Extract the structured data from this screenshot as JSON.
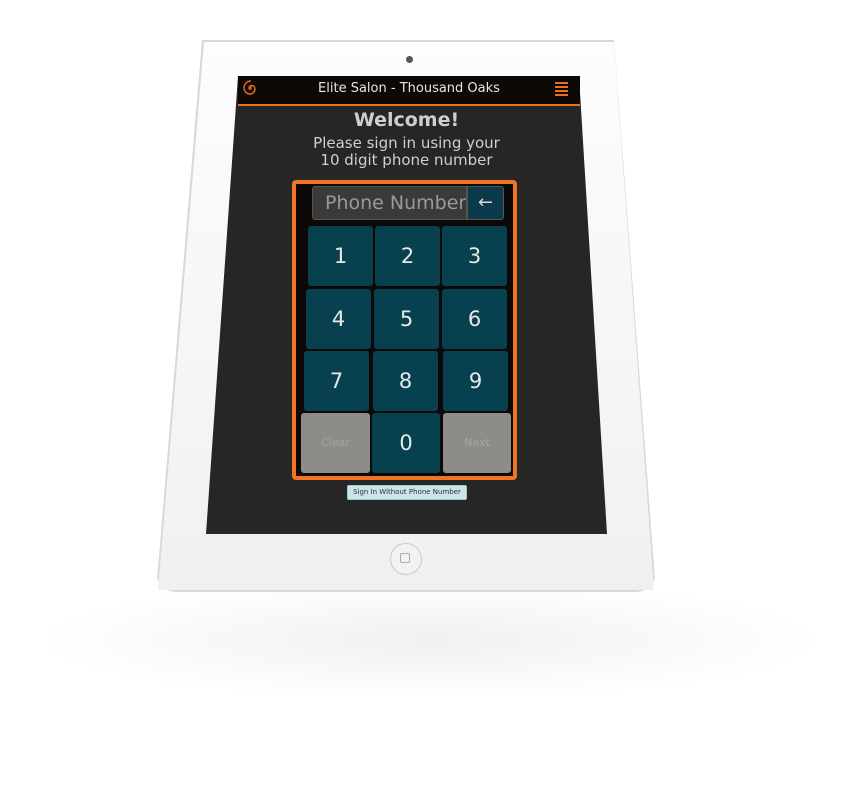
{
  "header": {
    "title": "Elite Salon - Thousand Oaks",
    "logo_icon": "spiral-logo-icon",
    "menu_icon": "hamburger-menu-icon"
  },
  "main": {
    "welcome": "Welcome!",
    "instructions_line1": "Please sign in using your",
    "instructions_line2": "10 digit phone number",
    "phone_input": {
      "value": "",
      "placeholder": "Phone Number"
    },
    "backspace_icon": "←",
    "keys": [
      "1",
      "2",
      "3",
      "4",
      "5",
      "6",
      "7",
      "8",
      "9",
      "Clear",
      "0",
      "Next"
    ],
    "sign_in_without_phone": "Sign In Without Phone Number"
  },
  "colors": {
    "accent": "#f07423",
    "key_bg": "#07404f",
    "disabled_key_bg": "#8e8c89",
    "screen_bg": "#262626"
  }
}
